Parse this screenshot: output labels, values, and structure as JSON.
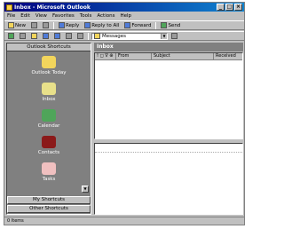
{
  "window": {
    "title": "Inbox - Microsoft Outlook",
    "minimize": "_",
    "maximize": "□",
    "close": "×"
  },
  "menu": [
    "File",
    "Edit",
    "View",
    "Favorites",
    "Tools",
    "Actions",
    "Help"
  ],
  "toolbar1": {
    "new_label": "New",
    "reply_label": "Reply",
    "reply_all_label": "Reply to All",
    "forward_label": "Forward",
    "send_label": "Send"
  },
  "toolbar2": {
    "folder_value": "Messages"
  },
  "outlook_bar": {
    "header": "Outlook Shortcuts",
    "items": [
      {
        "label": "Outlook Today",
        "icon": "outlook-today-icon",
        "color": "#f2d55c"
      },
      {
        "label": "Inbox",
        "icon": "inbox-icon",
        "color": "#e8e08a"
      },
      {
        "label": "Calendar",
        "icon": "calendar-icon",
        "color": "#4fa55a"
      },
      {
        "label": "Contacts",
        "icon": "contacts-icon",
        "color": "#8b1a1a"
      },
      {
        "label": "Tasks",
        "icon": "tasks-icon",
        "color": "#f0c0c0"
      }
    ],
    "groups": [
      "My Shortcuts",
      "Other Shortcuts"
    ]
  },
  "main": {
    "folder_title": "Inbox",
    "columns": [
      "! ◻ ∇ ⊕",
      "From",
      "Subject",
      "Received"
    ]
  },
  "status": {
    "text": "0 Items"
  }
}
